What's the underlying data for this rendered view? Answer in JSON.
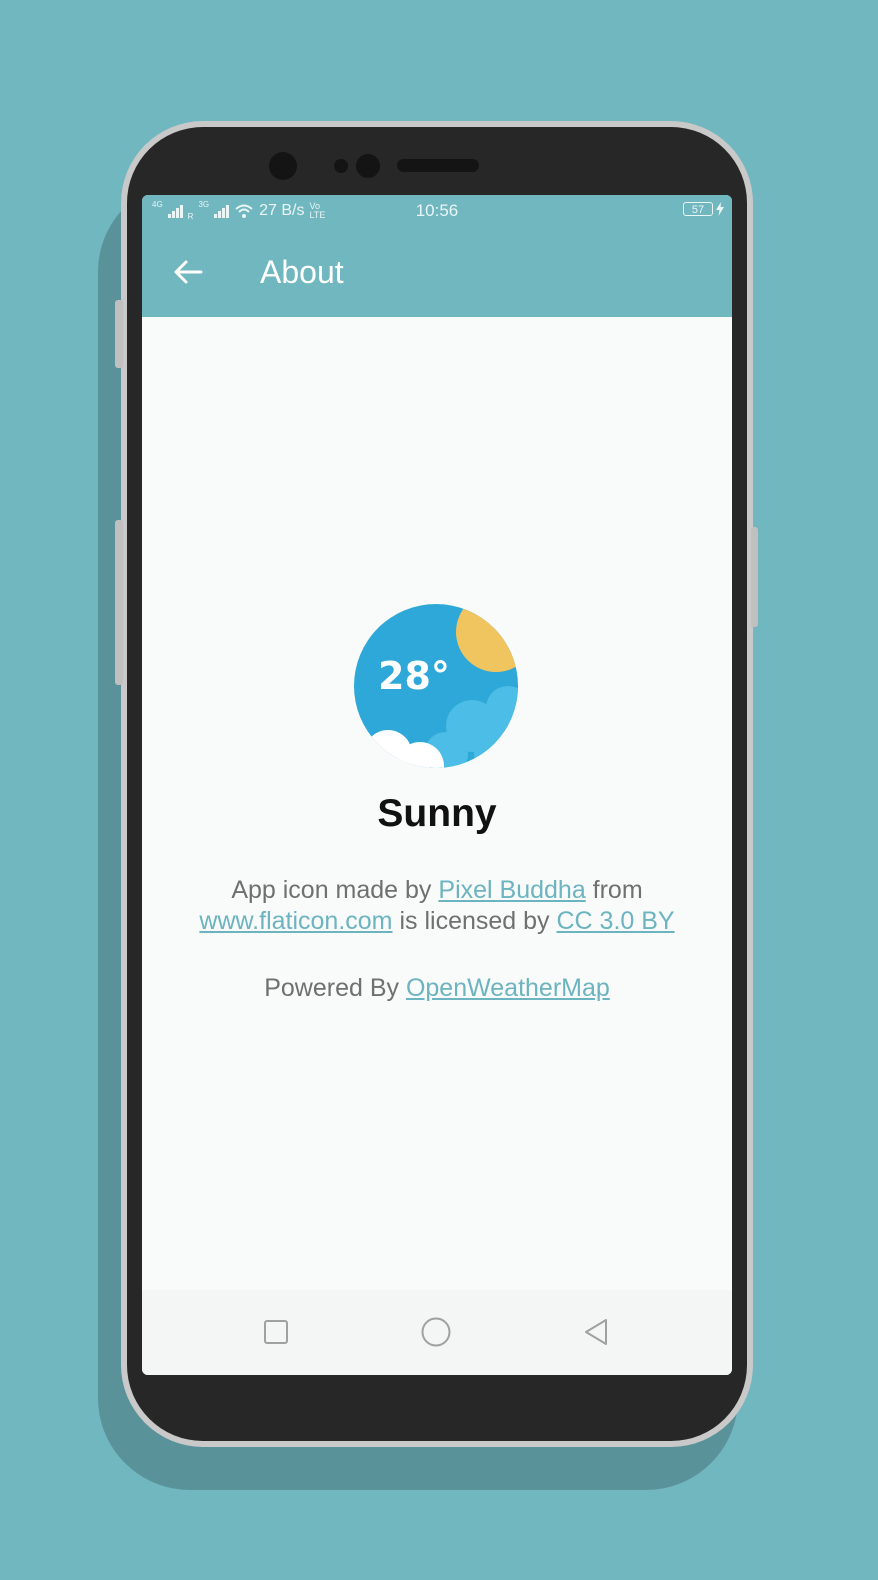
{
  "status_bar": {
    "network_left": "4G",
    "network_right": "3G",
    "roaming": "R",
    "speed": "27 B/s",
    "volte_top": "Vo",
    "volte_bottom": "LTE",
    "time": "10:56",
    "battery": "57"
  },
  "app_bar": {
    "title": "About",
    "back_icon": "arrow-left-icon"
  },
  "about": {
    "icon": {
      "temperature": "28°",
      "name": "weather-app-icon"
    },
    "app_name": "Sunny",
    "credit_prefix": "App icon made by ",
    "credit_author": "Pixel Buddha",
    "credit_mid": " from",
    "credit_site": "www.flaticon.com",
    "credit_license_text": " is licensed by ",
    "credit_license": "CC 3.0 BY",
    "powered_prefix": "Powered By ",
    "powered_link": "OpenWeatherMap"
  },
  "nav_bar": {
    "recents_icon": "square-icon",
    "home_icon": "circle-icon",
    "back_icon": "triangle-back-icon"
  },
  "colors": {
    "background": "#70b7c0",
    "app_bar": "#70b7c0",
    "link": "#6cb4bf",
    "icon_blue": "#2ea8d8",
    "icon_sun": "#f0c45e"
  }
}
